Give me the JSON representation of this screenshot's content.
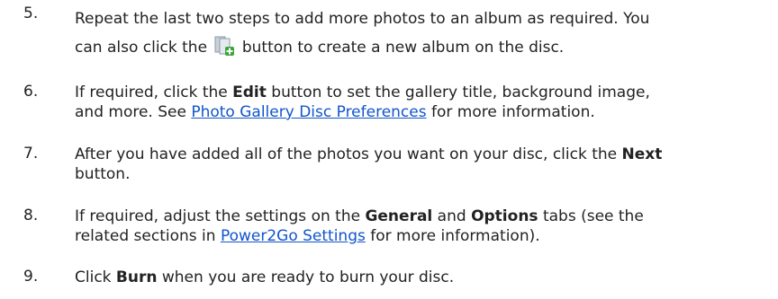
{
  "steps": [
    {
      "number": "5.",
      "line1": "Repeat the last two steps to add more photos to an album as required. You",
      "line2_before": "can also click the",
      "line2_after": "button to create a new album on the disc.",
      "icon": "new-album-icon"
    },
    {
      "number": "6.",
      "l1_a": "If required, click the ",
      "l1_bold": "Edit",
      "l1_b": " button to set the gallery title, background image,",
      "l2_a": "and more. See ",
      "l2_link": "Photo Gallery Disc Preferences",
      "l2_b": " for more information."
    },
    {
      "number": "7.",
      "l1_a": "After you have added all of the photos you want on your disc, click the ",
      "l1_bold": "Next",
      "l2": "button."
    },
    {
      "number": "8.",
      "l1_a": "If required, adjust the settings on the ",
      "l1_bold1": "General",
      "l1_mid": " and ",
      "l1_bold2": "Options",
      "l1_b": " tabs (see the",
      "l2_a": "related sections in ",
      "l2_link": "Power2Go Settings",
      "l2_b": " for more information)."
    },
    {
      "number": "9.",
      "a": "Click ",
      "bold": "Burn",
      "b": " when you are ready to burn your disc."
    }
  ],
  "colors": {
    "text": "#222222",
    "link": "#1155cc",
    "icon_page": "#8c9aa8",
    "icon_plus": "#3aa63a"
  }
}
